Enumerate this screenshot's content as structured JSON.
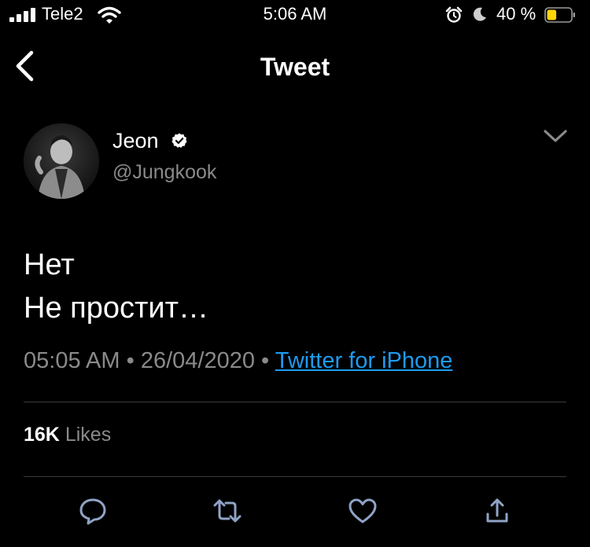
{
  "status_bar": {
    "carrier": "Tele2",
    "time": "5:06 AM",
    "battery_percent": "40 %",
    "battery_level": 0.4,
    "battery_color": "#ffd60a"
  },
  "nav": {
    "title": "Tweet",
    "back_icon": "chevron-left-icon"
  },
  "tweet": {
    "author_name": "Jeon",
    "handle": "@Jungkook",
    "verified": true,
    "lines": [
      "Нет",
      "Не простит…"
    ],
    "time": "05:05 AM",
    "date": "26/04/2020",
    "separator": "•",
    "source": "Twitter for iPhone",
    "likes_count": "16K",
    "likes_label": "Likes"
  },
  "actions": [
    "reply-icon",
    "retweet-icon",
    "like-icon",
    "share-icon"
  ],
  "colors": {
    "background": "#000000",
    "text": "#ffffff",
    "secondary": "#8a8a8a",
    "link": "#1d9bf0",
    "action_icon": "#8fa3c6"
  }
}
